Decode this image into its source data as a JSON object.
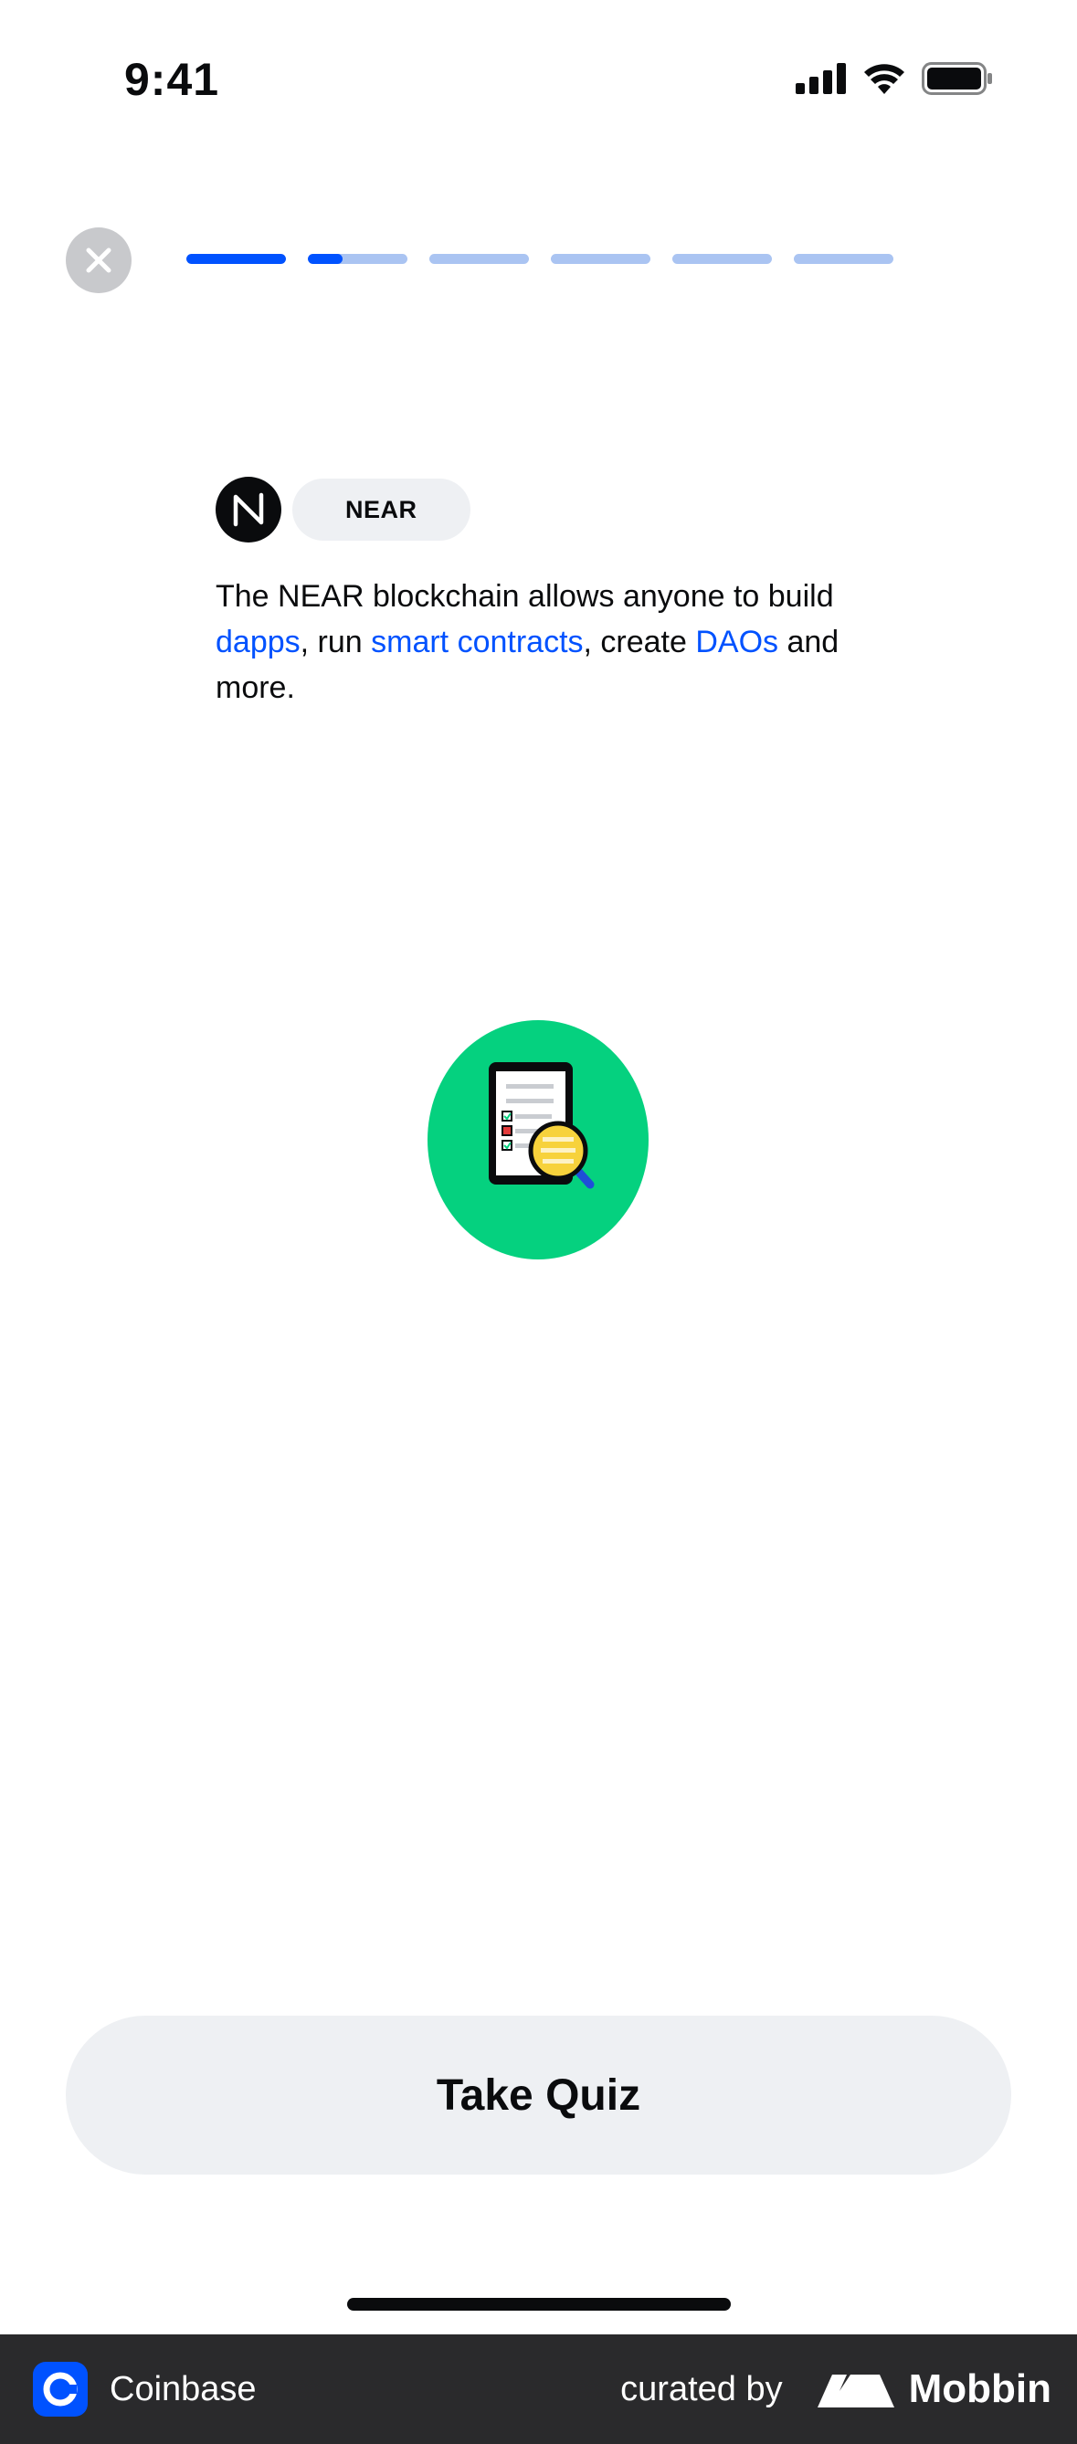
{
  "status_bar": {
    "time": "9:41"
  },
  "progress": {
    "segments": [
      1,
      0.35,
      0,
      0,
      0,
      0
    ]
  },
  "asset": {
    "chip_label": "NEAR",
    "logo_icon": "near-logo-icon"
  },
  "description": {
    "t1": "The NEAR blockchain allows anyone to build ",
    "link1": "dapps",
    "t2": ", run ",
    "link2": "smart contracts",
    "t3": ", create ",
    "link3": "DAOs",
    "t4": " and more."
  },
  "illustration": {
    "icon": "phone-checklist-magnifier-illustration"
  },
  "cta": {
    "label": "Take Quiz"
  },
  "footer": {
    "brand": "Coinbase",
    "curated": "curated by",
    "mobbin": "Mobbin"
  },
  "colors": {
    "accent": "#0052ff",
    "progress_inactive": "#aac4f2",
    "chip_bg": "#eef0f3",
    "illustration_bg": "#05d17f"
  }
}
